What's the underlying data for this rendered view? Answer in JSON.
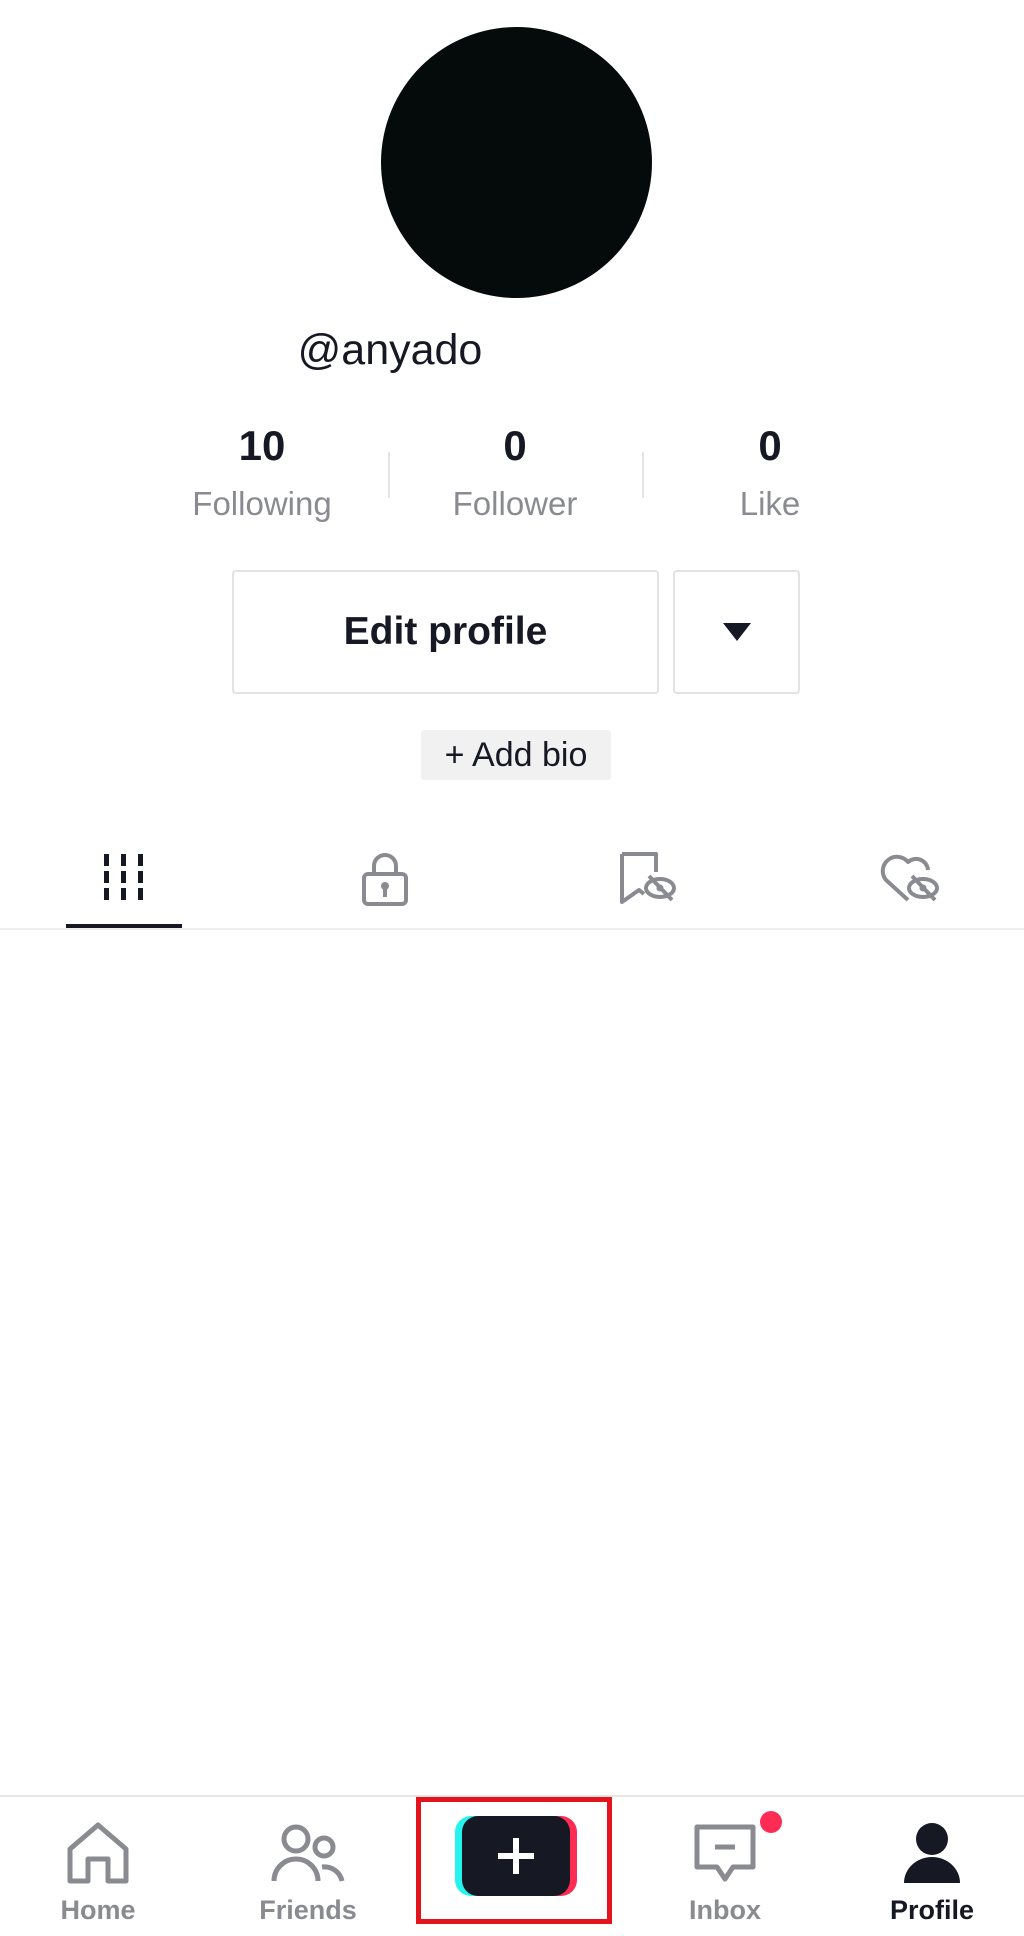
{
  "profile": {
    "username": "@anyado"
  },
  "stats": {
    "following": {
      "value": "10",
      "label": "Following"
    },
    "follower": {
      "value": "0",
      "label": "Follower"
    },
    "like": {
      "value": "0",
      "label": "Like"
    }
  },
  "actions": {
    "edit_profile_label": "Edit profile",
    "add_bio_label": "+ Add bio"
  },
  "tabs": [
    {
      "icon": "videos-grid-icon",
      "active": true
    },
    {
      "icon": "lock-icon",
      "active": false
    },
    {
      "icon": "bookmark-hidden-icon",
      "active": false
    },
    {
      "icon": "heart-hidden-icon",
      "active": false
    }
  ],
  "bottom_nav": {
    "home_label": "Home",
    "friends_label": "Friends",
    "inbox_label": "Inbox",
    "profile_label": "Profile"
  },
  "colors": {
    "text_primary": "#161823",
    "text_secondary": "#8a8b91",
    "brand_cyan": "#25f4ee",
    "brand_red": "#fe2c55",
    "highlight_box": "#e3141b"
  }
}
